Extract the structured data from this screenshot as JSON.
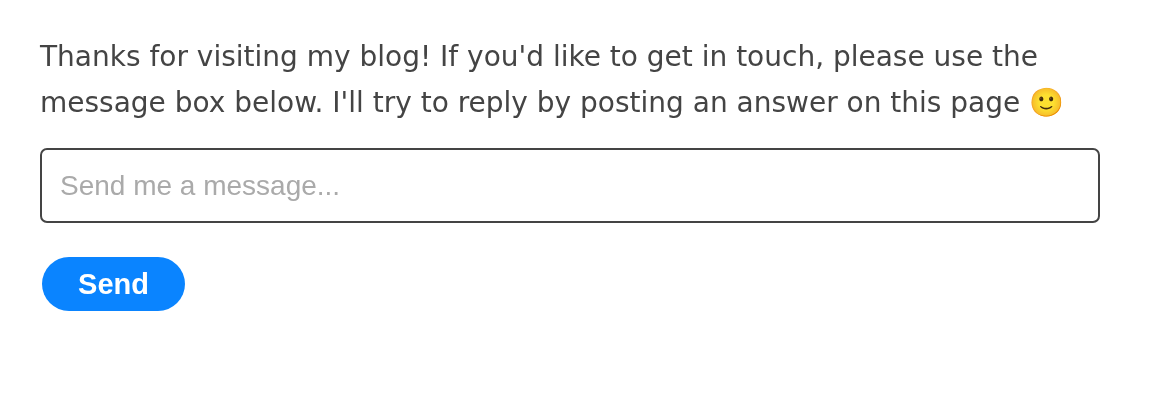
{
  "intro": {
    "text": "Thanks for visiting my blog! If you'd like to get in touch, please use the message box below. I'll try to reply by posting an answer on this page 🙂"
  },
  "message": {
    "placeholder": "Send me a message..."
  },
  "send_button": {
    "label": "Send"
  }
}
